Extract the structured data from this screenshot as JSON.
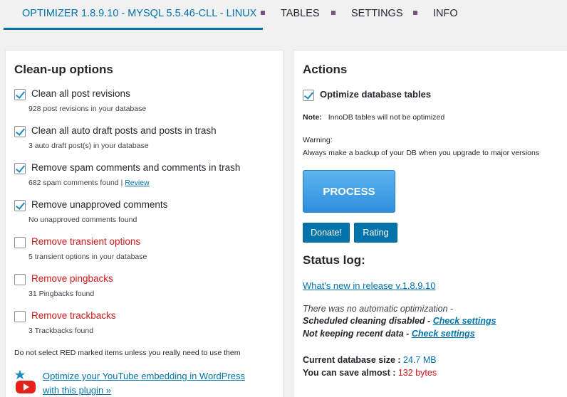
{
  "tabs": {
    "active": "OPTIMIZER 1.8.9.10 - MYSQL 5.5.46-CLL - LINUX",
    "tables": "TABLES",
    "settings": "SETTINGS",
    "info": "INFO"
  },
  "cleanup": {
    "title": "Clean-up options",
    "options": [
      {
        "label": "Clean all post revisions",
        "desc": "928 post revisions in your database",
        "checked": true,
        "red": false
      },
      {
        "label": "Clean all auto draft posts and posts in trash",
        "desc": "3 auto draft post(s) in your database",
        "checked": true,
        "red": false
      },
      {
        "label": "Remove spam comments and comments in trash",
        "desc": "682 spam comments found |",
        "desc_link": "Review",
        "checked": true,
        "red": false
      },
      {
        "label": "Remove unapproved comments",
        "desc": "No unapproved comments found",
        "checked": true,
        "red": false
      },
      {
        "label": "Remove transient options",
        "desc": "5 transient options in your database",
        "checked": false,
        "red": true
      },
      {
        "label": "Remove pingbacks",
        "desc": "31 Pingbacks found",
        "checked": false,
        "red": true
      },
      {
        "label": "Remove trackbacks",
        "desc": "3 Trackbacks found",
        "checked": false,
        "red": true
      }
    ],
    "warning": "Do not select RED marked items unless you really need to use them",
    "promo_line1": "Optimize your YouTube embedding in WordPress",
    "promo_line2": "with this plugin »"
  },
  "actions": {
    "title": "Actions",
    "optimize_label": "Optimize database tables",
    "note_label": "Note:",
    "note_text": "InnoDB tables will not be optimized",
    "warning_label": "Warning:",
    "warning_text": "Always make a backup of your DB when you upgrade to major versions",
    "process_label": "PROCESS",
    "donate_label": "Donate!",
    "rating_label": "Rating"
  },
  "status": {
    "title": "Status log:",
    "whats_new": "What's new in release v.1.8.9.10",
    "line1": "There was no automatic optimization -",
    "line2_text": "Scheduled cleaning disabled - ",
    "line2_link": "Check settings",
    "line3_text": "Not keeping recent data - ",
    "line3_link": "Check settings",
    "size_label": "Current database size : ",
    "size_value": "24.7 MB",
    "save_label": "You can save almost : ",
    "save_value": "132 bytes"
  },
  "colors": {
    "accent": "#0073aa",
    "danger": "#cc1818",
    "process": "#3a9be6"
  }
}
